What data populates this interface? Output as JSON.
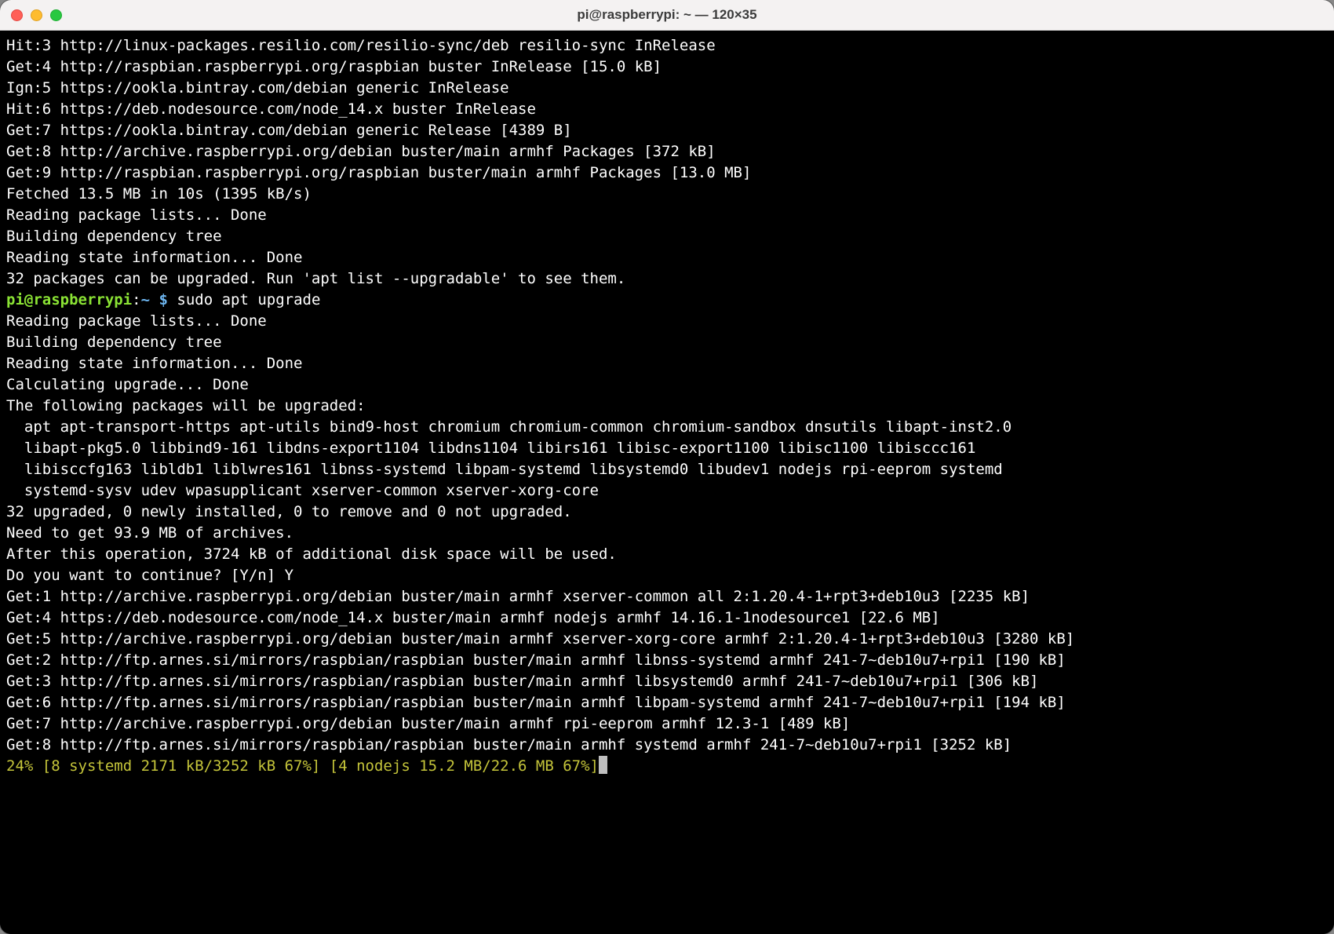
{
  "window": {
    "title": "pi@raspberrypi: ~ — 120×35"
  },
  "prompt": {
    "user_host": "pi@raspberrypi",
    "colon": ":",
    "path": "~",
    "dollar": " $ ",
    "command": "sudo apt upgrade"
  },
  "lines_before_prompt": [
    "Hit:3 http://linux-packages.resilio.com/resilio-sync/deb resilio-sync InRelease",
    "Get:4 http://raspbian.raspberrypi.org/raspbian buster InRelease [15.0 kB]",
    "Ign:5 https://ookla.bintray.com/debian generic InRelease",
    "Hit:6 https://deb.nodesource.com/node_14.x buster InRelease",
    "Get:7 https://ookla.bintray.com/debian generic Release [4389 B]",
    "Get:8 http://archive.raspberrypi.org/debian buster/main armhf Packages [372 kB]",
    "Get:9 http://raspbian.raspberrypi.org/raspbian buster/main armhf Packages [13.0 MB]",
    "Fetched 13.5 MB in 10s (1395 kB/s)",
    "Reading package lists... Done",
    "Building dependency tree",
    "Reading state information... Done",
    "32 packages can be upgraded. Run 'apt list --upgradable' to see them."
  ],
  "lines_after_prompt": [
    "Reading package lists... Done",
    "Building dependency tree",
    "Reading state information... Done",
    "Calculating upgrade... Done",
    "The following packages will be upgraded:",
    "  apt apt-transport-https apt-utils bind9-host chromium chromium-common chromium-sandbox dnsutils libapt-inst2.0",
    "  libapt-pkg5.0 libbind9-161 libdns-export1104 libdns1104 libirs161 libisc-export1100 libisc1100 libisccc161",
    "  libisccfg163 libldb1 liblwres161 libnss-systemd libpam-systemd libsystemd0 libudev1 nodejs rpi-eeprom systemd",
    "  systemd-sysv udev wpasupplicant xserver-common xserver-xorg-core",
    "32 upgraded, 0 newly installed, 0 to remove and 0 not upgraded.",
    "Need to get 93.9 MB of archives.",
    "After this operation, 3724 kB of additional disk space will be used.",
    "Do you want to continue? [Y/n] Y",
    "Get:1 http://archive.raspberrypi.org/debian buster/main armhf xserver-common all 2:1.20.4-1+rpt3+deb10u3 [2235 kB]",
    "Get:4 https://deb.nodesource.com/node_14.x buster/main armhf nodejs armhf 14.16.1-1nodesource1 [22.6 MB]",
    "Get:5 http://archive.raspberrypi.org/debian buster/main armhf xserver-xorg-core armhf 2:1.20.4-1+rpt3+deb10u3 [3280 kB]",
    "Get:2 http://ftp.arnes.si/mirrors/raspbian/raspbian buster/main armhf libnss-systemd armhf 241-7~deb10u7+rpi1 [190 kB]",
    "Get:3 http://ftp.arnes.si/mirrors/raspbian/raspbian buster/main armhf libsystemd0 armhf 241-7~deb10u7+rpi1 [306 kB]",
    "Get:6 http://ftp.arnes.si/mirrors/raspbian/raspbian buster/main armhf libpam-systemd armhf 241-7~deb10u7+rpi1 [194 kB]",
    "Get:7 http://archive.raspberrypi.org/debian buster/main armhf rpi-eeprom armhf 12.3-1 [489 kB]",
    "Get:8 http://ftp.arnes.si/mirrors/raspbian/raspbian buster/main armhf systemd armhf 241-7~deb10u7+rpi1 [3252 kB]"
  ],
  "progress_line": "24% [8 systemd 2171 kB/3252 kB 67%] [4 nodejs 15.2 MB/22.6 MB 67%]"
}
